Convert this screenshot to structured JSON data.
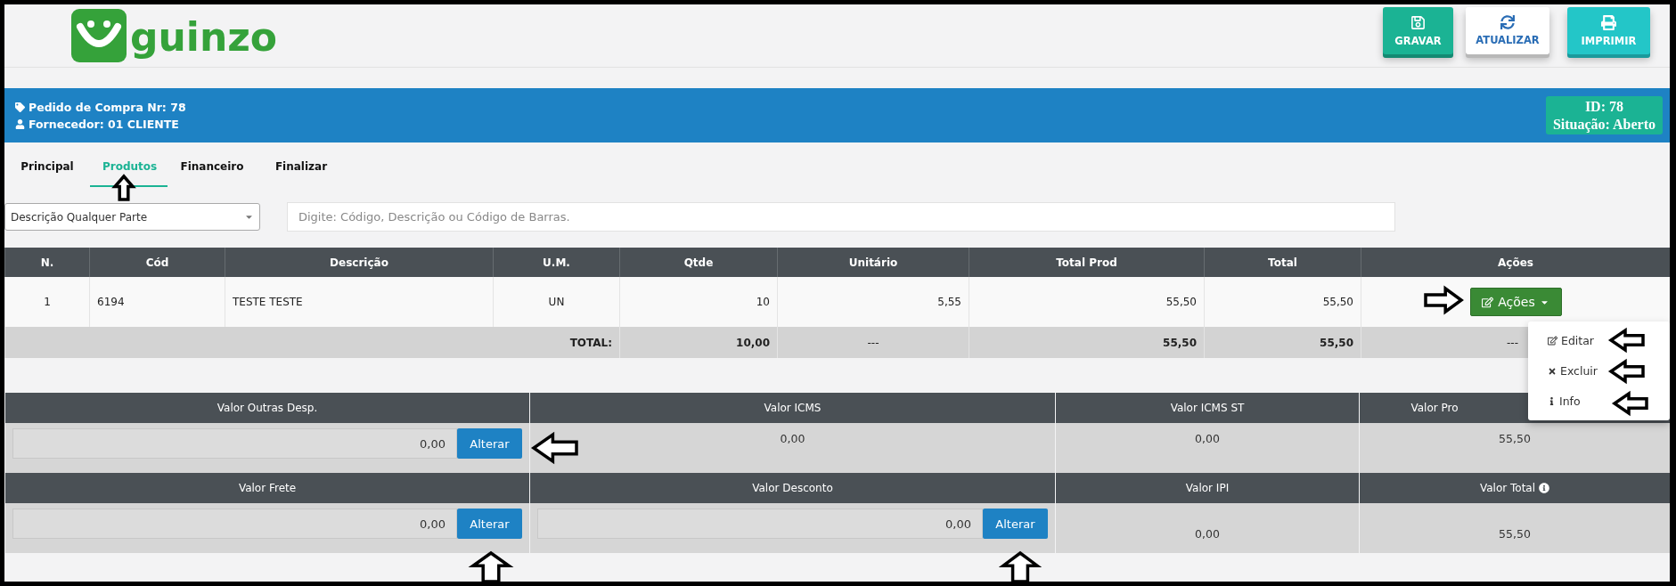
{
  "logo": {
    "text": "guinzo"
  },
  "toolbar": [
    {
      "label": "GRAVAR",
      "kind": "save"
    },
    {
      "label": "ATUALIZAR",
      "kind": "refresh"
    },
    {
      "label": "IMPRIMIR",
      "kind": "print"
    }
  ],
  "order_header": {
    "order": "Pedido de Compra Nr: 78",
    "supplier": "Fornecedor: 01 CLIENTE",
    "id": "ID: 78",
    "status": "Situação: Aberto"
  },
  "tabs": [
    {
      "label": "Principal",
      "selected": false
    },
    {
      "label": "Produtos",
      "selected": true
    },
    {
      "label": "Financeiro",
      "selected": false
    },
    {
      "label": "Finalizar",
      "selected": false
    }
  ],
  "search": {
    "mode": "Descrição Qualquer Parte",
    "placeholder": "Digite: Código, Descrição ou Código de Barras."
  },
  "table": {
    "columns": [
      "N.",
      "Cód",
      "Descrição",
      "U.M.",
      "Qtde",
      "Unitário",
      "Total Prod",
      "Total",
      "Ações"
    ],
    "rows": [
      {
        "cells": [
          "1",
          "6194",
          "TESTE TESTE",
          "UN",
          "10",
          "5,55",
          "55,50",
          "55,50"
        ],
        "action": "Ações"
      }
    ],
    "total_row": {
      "label": "TOTAL:",
      "cells": [
        "10,00",
        "---",
        "55,50",
        "55,50",
        "---"
      ]
    }
  },
  "actions_menu": [
    {
      "label": "Editar",
      "kind": "edit"
    },
    {
      "label": "Excluir",
      "kind": "delete"
    },
    {
      "label": "Info",
      "kind": "info"
    }
  ],
  "summary": [
    [
      {
        "label": "Valor Outras Desp.",
        "value": "0,00",
        "kind": "editable",
        "button": "Alterar"
      },
      {
        "label": "Valor ICMS",
        "value": "0,00",
        "kind": "readonly"
      },
      {
        "label": "Valor ICMS ST",
        "value": "0,00",
        "kind": "readonly"
      },
      {
        "label": "Valor Pro",
        "value": "55,50",
        "kind": "readonly"
      }
    ],
    [
      {
        "label": "Valor Frete",
        "value": "0,00",
        "kind": "editable",
        "button": "Alterar"
      },
      {
        "label": "Valor Desconto",
        "value": "0,00",
        "kind": "editable",
        "button": "Alterar"
      },
      {
        "label": "Valor IPI",
        "value": "0,00",
        "kind": "readonly"
      },
      {
        "label": "Valor Total",
        "value": "55,50",
        "kind": "readonly",
        "info_icon": true
      }
    ]
  ]
}
